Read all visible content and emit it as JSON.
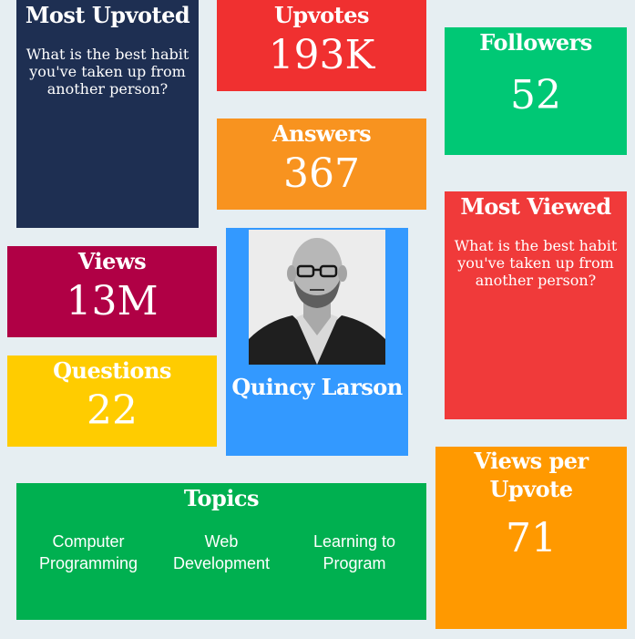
{
  "most_upvoted": {
    "title": "Most Upvoted",
    "question": "What is the best habit you've taken up from another person?"
  },
  "upvotes": {
    "title": "Upvotes",
    "value": "193K"
  },
  "followers": {
    "title": "Followers",
    "value": "52"
  },
  "answers": {
    "title": "Answers",
    "value": "367"
  },
  "most_viewed": {
    "title": "Most Viewed",
    "question": "What is the best habit you've taken up from another person?"
  },
  "views": {
    "title": "Views",
    "value": "13M"
  },
  "profile": {
    "name": "Quincy Larson"
  },
  "questions": {
    "title": "Questions",
    "value": "22"
  },
  "views_per_upvote": {
    "title": "Views per Upvote",
    "value": "71"
  },
  "topics": {
    "title": "Topics",
    "items": [
      "Computer Programming",
      "Web Development",
      "Learning to Program"
    ]
  },
  "colors": {
    "background": "#e6eef2",
    "navy": "#1e2f52",
    "red": "#f03030",
    "green": "#00c875",
    "orange": "#f8931f",
    "crimson": "#b00045",
    "blue": "#3399ff",
    "yellow": "#ffcc00",
    "amber": "#ff9900",
    "topics_green": "#00b050"
  }
}
